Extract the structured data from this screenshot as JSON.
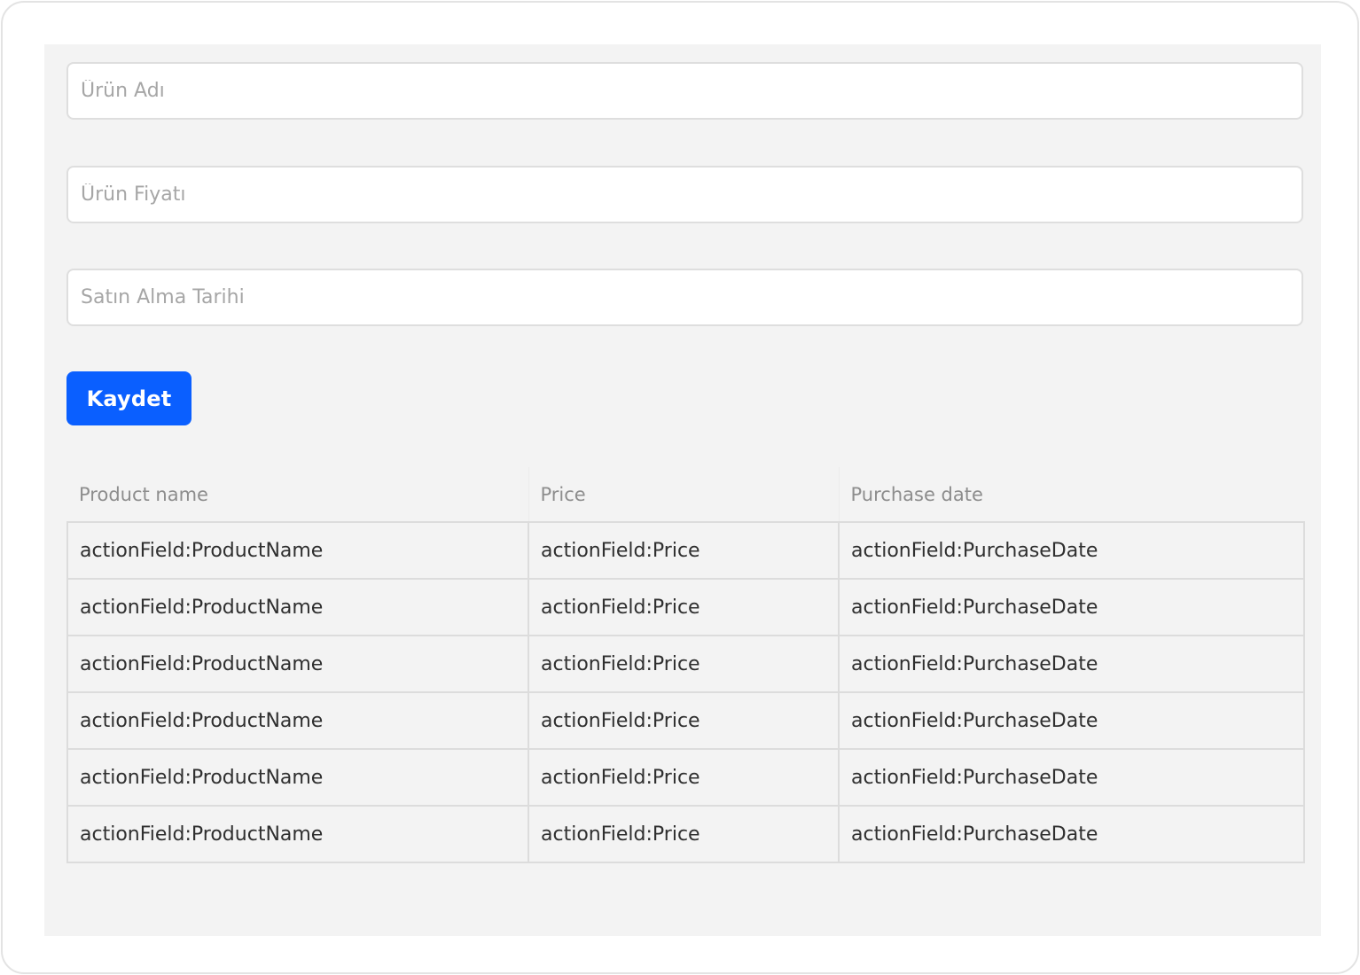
{
  "form": {
    "product_name": {
      "placeholder": "Ürün Adı",
      "value": ""
    },
    "product_price": {
      "placeholder": "Ürün Fiyatı",
      "value": ""
    },
    "purchase_date": {
      "placeholder": "Satın Alma Tarihi",
      "value": ""
    },
    "save_label": "Kaydet"
  },
  "colors": {
    "accent": "#0a5fff",
    "panel_background": "#f3f3f3",
    "border": "#dcdcdc"
  },
  "table": {
    "headers": [
      "Product name",
      "Price",
      "Purchase date"
    ],
    "rows": [
      [
        "actionField:ProductName",
        "actionField:Price",
        "actionField:PurchaseDate"
      ],
      [
        "actionField:ProductName",
        "actionField:Price",
        "actionField:PurchaseDate"
      ],
      [
        "actionField:ProductName",
        "actionField:Price",
        "actionField:PurchaseDate"
      ],
      [
        "actionField:ProductName",
        "actionField:Price",
        "actionField:PurchaseDate"
      ],
      [
        "actionField:ProductName",
        "actionField:Price",
        "actionField:PurchaseDate"
      ],
      [
        "actionField:ProductName",
        "actionField:Price",
        "actionField:PurchaseDate"
      ]
    ]
  }
}
